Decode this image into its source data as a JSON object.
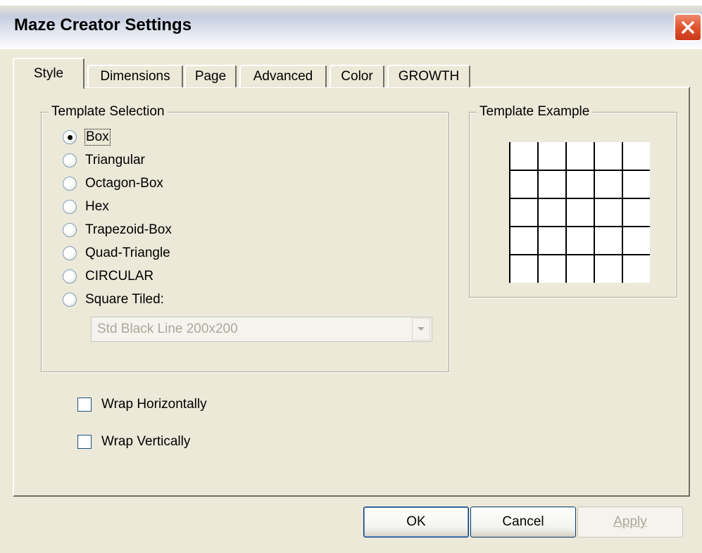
{
  "window": {
    "title": "Maze Creator Settings"
  },
  "tabs": [
    {
      "label": "Style",
      "active": true
    },
    {
      "label": "Dimensions"
    },
    {
      "label": "Page"
    },
    {
      "label": "Advanced"
    },
    {
      "label": "Color"
    },
    {
      "label": "GROWTH"
    }
  ],
  "template_selection": {
    "legend": "Template Selection",
    "options": [
      {
        "label": "Box",
        "selected": true
      },
      {
        "label": "Triangular"
      },
      {
        "label": "Octagon-Box"
      },
      {
        "label": "Hex"
      },
      {
        "label": "Trapezoid-Box"
      },
      {
        "label": "Quad-Triangle"
      },
      {
        "label": "CIRCULAR"
      },
      {
        "label": "Square Tiled:"
      }
    ],
    "tiled_select": {
      "value": "Std Black Line 200x200",
      "disabled": true
    }
  },
  "template_example": {
    "legend": "Template Example"
  },
  "options": {
    "wrap_horizontally": {
      "label": "Wrap Horizontally",
      "checked": false
    },
    "wrap_vertically": {
      "label": "Wrap Vertically",
      "checked": false
    }
  },
  "buttons": {
    "ok": "OK",
    "cancel": "Cancel",
    "apply": "Apply"
  },
  "colors": {
    "close_button": "#e0532e",
    "window_bg": "#ece9d8",
    "button_border": "#003c74"
  }
}
